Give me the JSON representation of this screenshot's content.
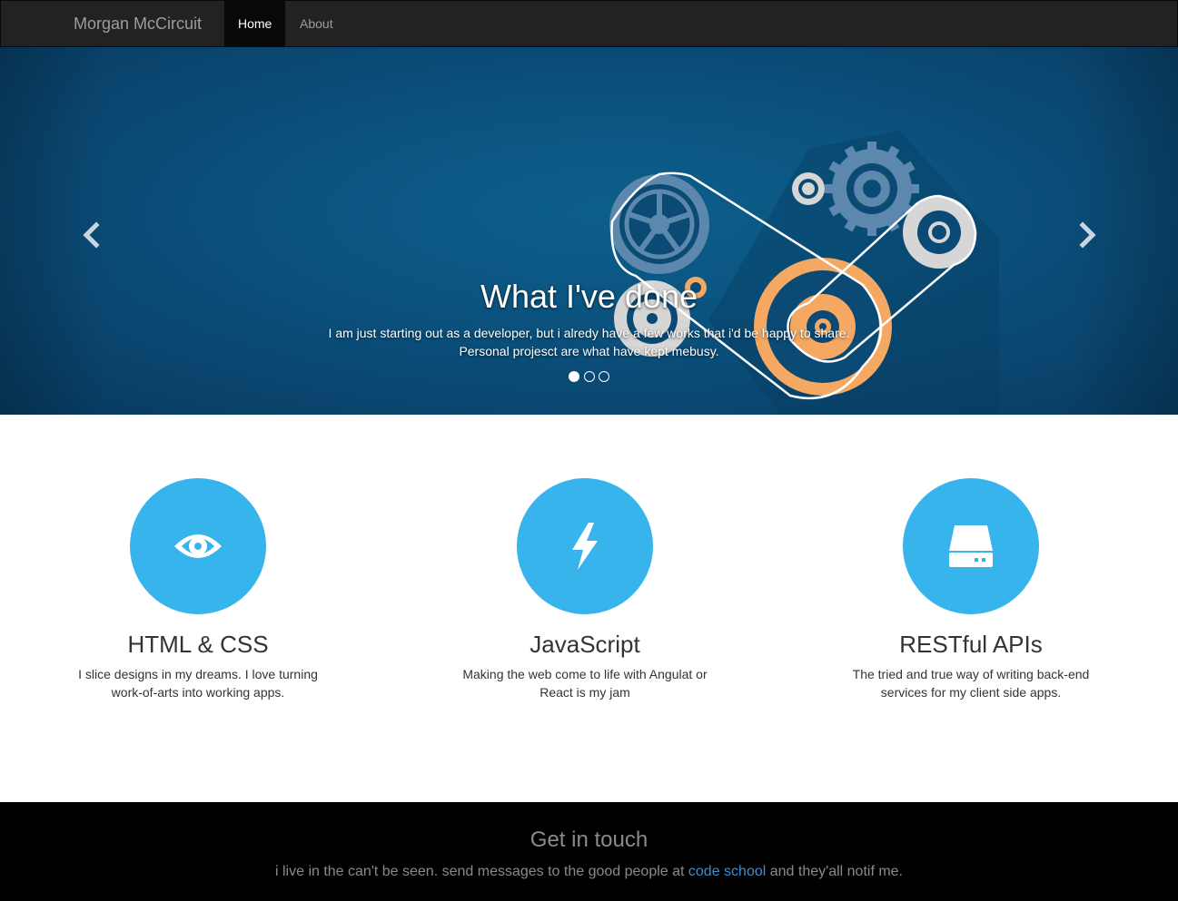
{
  "navbar": {
    "brand": "Morgan McCircuit",
    "items": [
      {
        "label": "Home",
        "active": true
      },
      {
        "label": "About",
        "active": false
      }
    ]
  },
  "carousel": {
    "title": "What I've done",
    "text_line1": "I am just starting out as a developer, but i alredy have a few works that i'd be happy to share.",
    "text_line2": "Personal projesct are what have kept mebusy.",
    "slide_count": 3,
    "active_slide": 1,
    "prev_icon": "chevron-left-icon",
    "next_icon": "chevron-right-icon"
  },
  "features": [
    {
      "icon": "eye-icon",
      "title": "HTML & CSS",
      "text": "I slice designs in my dreams. I love turning work-of-arts into working apps."
    },
    {
      "icon": "bolt-icon",
      "title": "JavaScript",
      "text": "Making the web come to life with Angulat or React is my jam"
    },
    {
      "icon": "server-icon",
      "title": "RESTful APIs",
      "text": "The tried and true way of writing back-end services for my client side apps."
    }
  ],
  "footer": {
    "title": "Get in touch",
    "text_before": "i live in the can't be seen. send messages to the good people at",
    "link_text": "code school",
    "text_after": "and they'all notif me."
  },
  "colors": {
    "accent": "#37b4ec",
    "navbar_bg": "#222222",
    "carousel_bg": "#0a4a74",
    "footer_bg": "#000000",
    "link": "#3a8fd6",
    "gear_orange": "#f5a862",
    "gear_grey": "#d6d6d6",
    "gear_blue": "#6f97b8"
  }
}
